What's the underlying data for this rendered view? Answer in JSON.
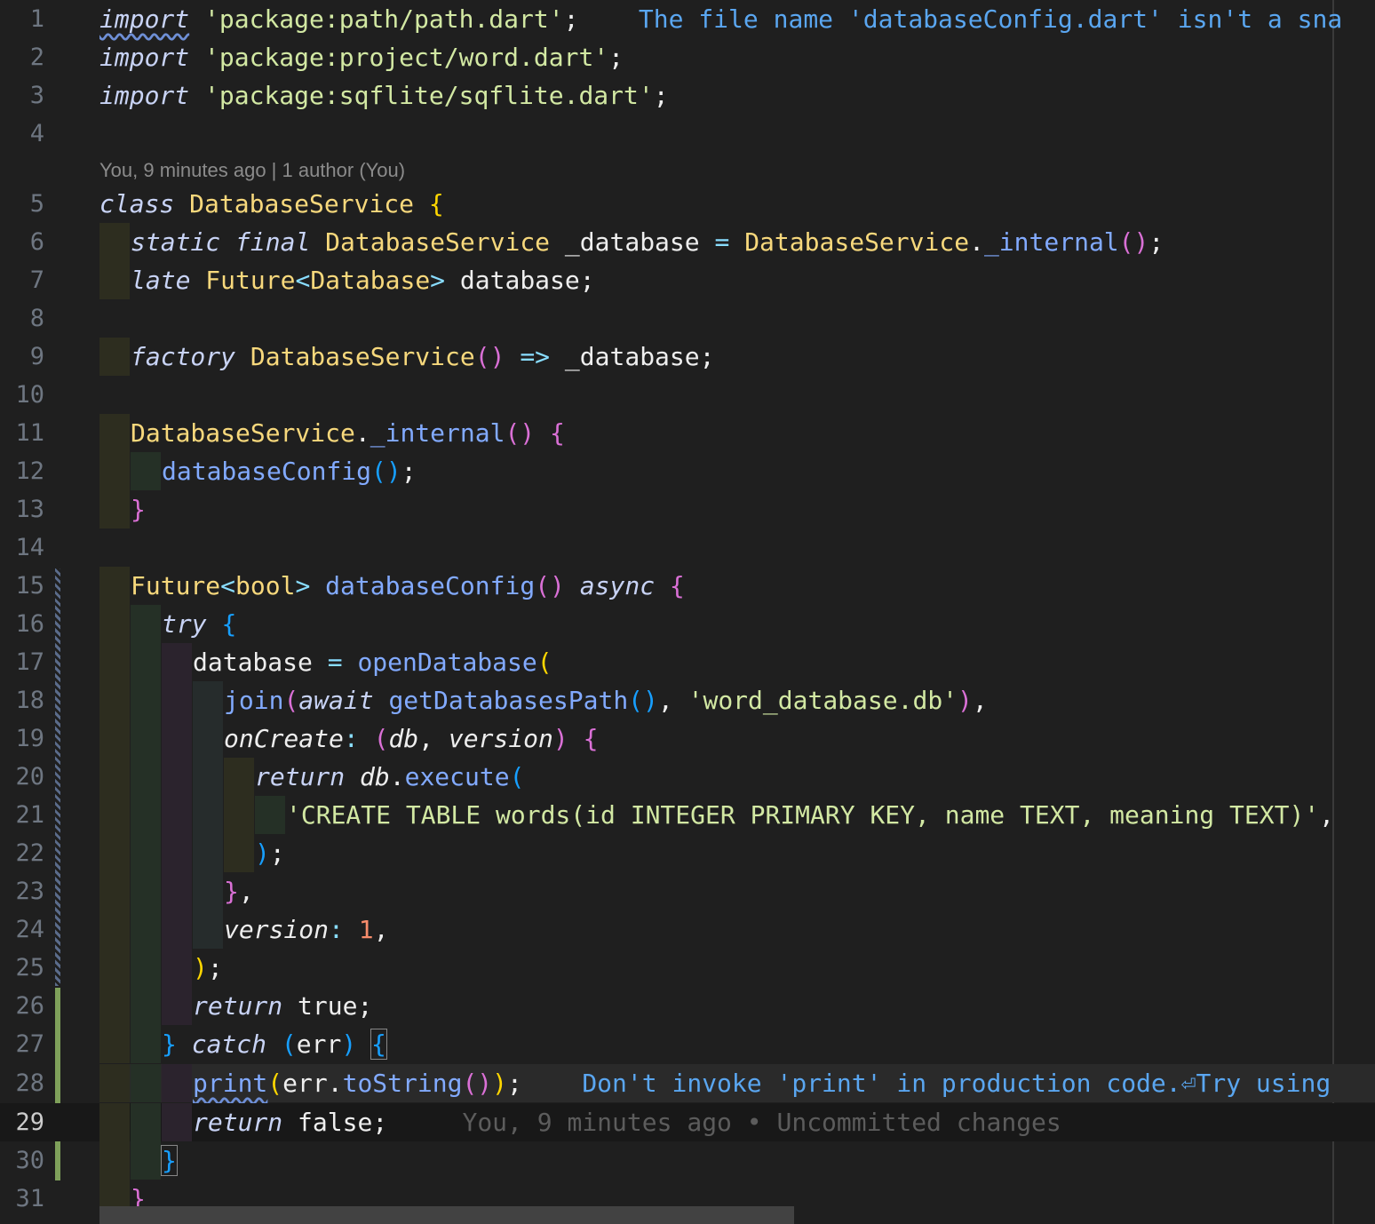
{
  "editor": {
    "file_warning": "The file name 'databaseConfig.dart' isn't a sna",
    "codelens": "You, 9 minutes ago | 1 author (You)",
    "print_warning": "Don't invoke 'print' in production code.⏎Try using",
    "blame_inline": "You, 9 minutes ago • Uncommitted changes",
    "line_numbers": [
      "1",
      "2",
      "3",
      "4",
      "5",
      "6",
      "7",
      "8",
      "9",
      "10",
      "11",
      "12",
      "13",
      "14",
      "15",
      "16",
      "17",
      "18",
      "19",
      "20",
      "21",
      "22",
      "23",
      "24",
      "25",
      "26",
      "27",
      "28",
      "29",
      "30",
      "31"
    ],
    "code": {
      "l1_kw": "import",
      "l1_str": "'package:path/path.dart'",
      "l2_kw": "import",
      "l2_str": "'package:project/word.dart'",
      "l3_kw": "import",
      "l3_str": "'package:sqflite/sqflite.dart'",
      "l5_kw": "class",
      "l5_type": "DatabaseService",
      "l6_kw1": "static",
      "l6_kw2": "final",
      "l6_type": "DatabaseService",
      "l6_var": "_database",
      "l6_type2": "DatabaseService",
      "l6_fn": "_internal",
      "l7_kw": "late",
      "l7_type": "Future",
      "l7_type2": "Database",
      "l7_var": "database",
      "l9_kw": "factory",
      "l9_type": "DatabaseService",
      "l9_var": "_database",
      "l11_type": "DatabaseService",
      "l11_fn": "_internal",
      "l12_fn": "databaseConfig",
      "l15_type": "Future",
      "l15_type2": "bool",
      "l15_fn": "databaseConfig",
      "l15_kw": "async",
      "l16_kw": "try",
      "l17_var": "database",
      "l17_fn": "openDatabase",
      "l18_fn": "join",
      "l18_kw": "await",
      "l18_fn2": "getDatabasesPath",
      "l18_str": "'word_database.db'",
      "l19_param": "onCreate",
      "l19_p1": "db",
      "l19_p2": "version",
      "l20_kw": "return",
      "l20_p": "db",
      "l20_fn": "execute",
      "l21_str": "'CREATE TABLE words(id INTEGER PRIMARY KEY, name TEXT, meaning TEXT)'",
      "l24_param": "version",
      "l24_num": "1",
      "l26_kw": "return",
      "l26_val": "true",
      "l27_kw": "catch",
      "l27_var": "err",
      "l28_fn": "print",
      "l28_var": "err",
      "l28_fn2": "toString",
      "l29_kw": "return",
      "l29_val": "false"
    }
  },
  "colors": {
    "background": "#1f1f1f",
    "keyword": "#9cdcfe",
    "string": "#d2e8a3",
    "type": "#f7d87c",
    "function": "#82aaff",
    "number": "#f78c6c",
    "diagnostic": "#5aa6f0",
    "scm_added": "#7ea05a"
  }
}
